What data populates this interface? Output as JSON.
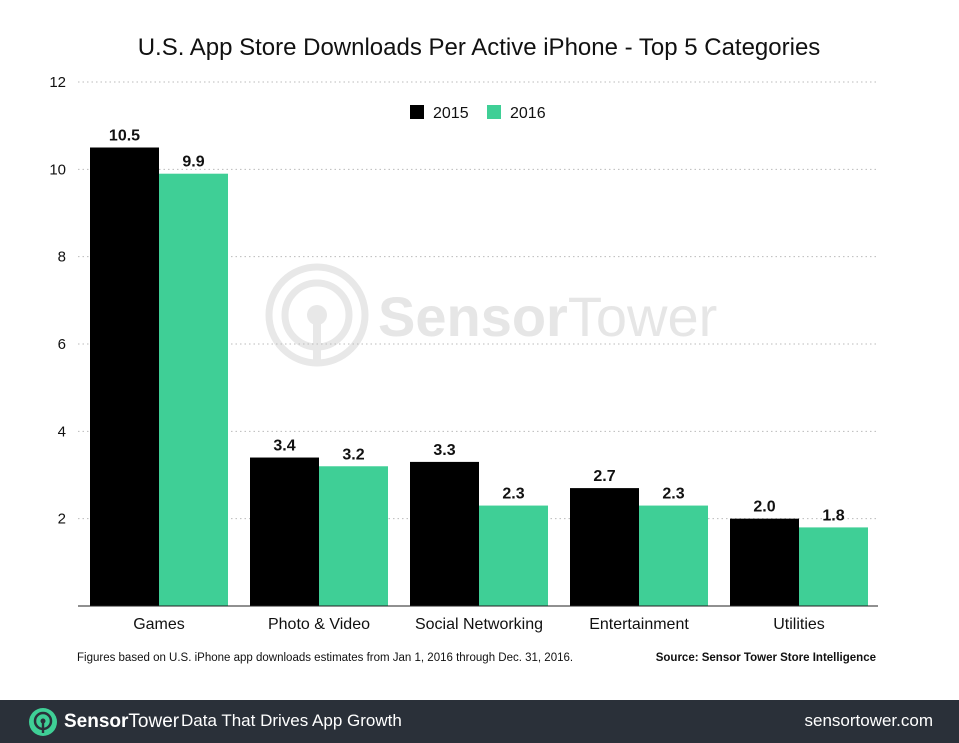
{
  "chart_data": {
    "type": "bar",
    "title": "U.S. App Store Downloads Per Active iPhone - Top 5 Categories",
    "xlabel": "",
    "ylabel": "",
    "ylim": [
      0,
      12
    ],
    "yticks": [
      2,
      4,
      6,
      8,
      10,
      12
    ],
    "ytick_labels": [
      "2",
      "4",
      "6",
      "8",
      "10",
      "12"
    ],
    "grid": true,
    "legend_position": "top-center",
    "categories": [
      "Games",
      "Photo & Video",
      "Social Networking",
      "Entertainment",
      "Utilities"
    ],
    "series": [
      {
        "name": "2015",
        "color": "#000000",
        "values": [
          10.5,
          3.4,
          3.3,
          2.7,
          2.0
        ],
        "labels": [
          "10.5",
          "3.4",
          "3.3",
          "2.7",
          "2.0"
        ]
      },
      {
        "name": "2016",
        "color": "#3fcf96",
        "values": [
          9.9,
          3.2,
          2.3,
          2.3,
          1.8
        ],
        "labels": [
          "9.9",
          "3.2",
          "2.3",
          "2.3",
          "1.8"
        ]
      }
    ],
    "footnote": "Figures based on U.S. iPhone app downloads estimates from Jan 1, 2016 through Dec. 31, 2016.",
    "source": "Source: Sensor Tower Store Intelligence",
    "watermark": {
      "light": "Sensor",
      "regular": "Tower"
    }
  },
  "footer": {
    "brand_bold": "Sensor",
    "brand_regular": "Tower",
    "tagline": "Data That Drives App Growth",
    "site": "sensortower.com",
    "accent": "#3fcf96"
  }
}
